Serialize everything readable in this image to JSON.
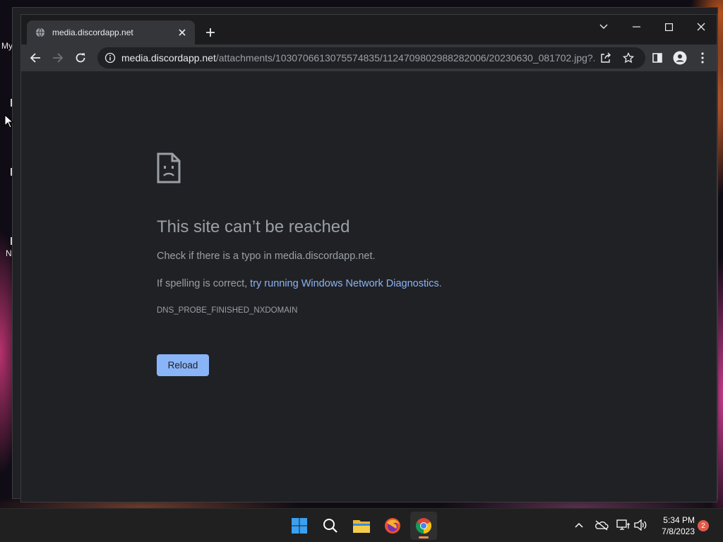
{
  "desktop": {
    "label_my": "My",
    "label_n": "N"
  },
  "tab": {
    "title": "media.discordapp.net",
    "icon": "globe-icon"
  },
  "toolbar": {
    "url_host": "media.discordapp.net",
    "url_path": "/attachments/1030706613075574835/1124709802988282006/20230630_081702.jpg?..."
  },
  "error": {
    "icon": "sad-page-icon",
    "title": "This site can’t be reached",
    "line1": "Check if there is a typo in media.discordapp.net.",
    "line2_prefix": "If spelling is correct, ",
    "line2_link": "try running Windows Network Diagnostics",
    "line2_suffix": ".",
    "code": "DNS_PROBE_FINISHED_NXDOMAIN",
    "reload_label": "Reload"
  },
  "taskbar": {
    "apps": [
      "start-icon",
      "search-icon",
      "file-explorer-icon",
      "firefox-icon",
      "chrome-icon"
    ],
    "active_app": "chrome-icon",
    "time": "5:34 PM",
    "date": "7/8/2023",
    "notification_count": "2"
  },
  "colors": {
    "link": "#8ab4f8",
    "button": "#8ab4f8",
    "page_bg": "#202124",
    "toolbar_bg": "#35363a",
    "badge": "#e05a4a"
  }
}
